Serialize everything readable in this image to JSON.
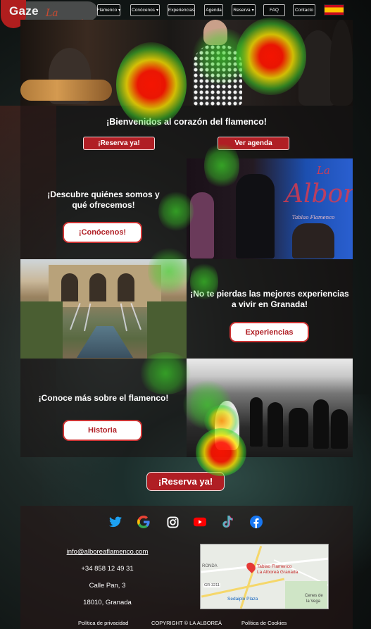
{
  "brand": {
    "name": "Gaze",
    "subtitle": "La alboreá",
    "logo_icon": "flamenco-logo"
  },
  "nav": {
    "items": [
      {
        "label": "Flamenco",
        "has_caret": true
      },
      {
        "label": "Conócenos",
        "has_caret": true
      },
      {
        "label": "Experiencias",
        "has_caret": false
      },
      {
        "label": "Agenda",
        "has_caret": false
      },
      {
        "label": "Reserva",
        "has_caret": true
      },
      {
        "label": "FAQ",
        "has_caret": false
      },
      {
        "label": "Contacto",
        "has_caret": false
      }
    ],
    "language_flag": "spain-flag"
  },
  "welcome": {
    "title": "¡Bienvenidos al corazón del flamenco!",
    "reserve_button": "¡Reserva ya!",
    "agenda_button": "Ver agenda"
  },
  "sections": [
    {
      "title_line1": "¡Descubre quiénes somos y",
      "title_line2": "qué ofrecemos!",
      "button": "¡Conócenos!"
    },
    {
      "title_line1": "¡No te pierdas las mejores experiencias",
      "title_line2": "a vivir en Granada!",
      "button": "Experiencias"
    },
    {
      "title_line1": "¡Conoce más sobre el flamenco!",
      "title_line2": "",
      "button": "Historia"
    }
  ],
  "stage_photo": {
    "logo_la": "La",
    "logo_text": "AlboreA",
    "logo_tag": "Tablao Flamenco"
  },
  "cta": {
    "button": "¡Reserva ya!"
  },
  "social": [
    "twitter-icon",
    "google-icon",
    "instagram-icon",
    "youtube-icon",
    "tiktok-icon",
    "facebook-icon"
  ],
  "contact": {
    "email": "info@alboreaflamenco.com",
    "phone": "+34 858 12 49 31",
    "street": "Calle Pan, 3",
    "city": "18010, Granada"
  },
  "map": {
    "pin_label_line1": "Tablao Flamenco",
    "pin_label_line2": "La Alboreá Granada",
    "place_1": "Sedaiplo Plaza",
    "place_2": "Cenes de",
    "place_3": "la Vega",
    "place_4": "RONDA",
    "road_1": "GR-3211"
  },
  "legal": {
    "privacy": "Política de privacidad",
    "copyright": "COPYRIGHT © LA ALBOREÁ",
    "cookies": "Política de Cookies"
  },
  "colors": {
    "brand_red": "#b01e24",
    "heat_red": "#ff1a00",
    "heat_yellow": "#ffee00",
    "heat_green": "#33cc33"
  }
}
